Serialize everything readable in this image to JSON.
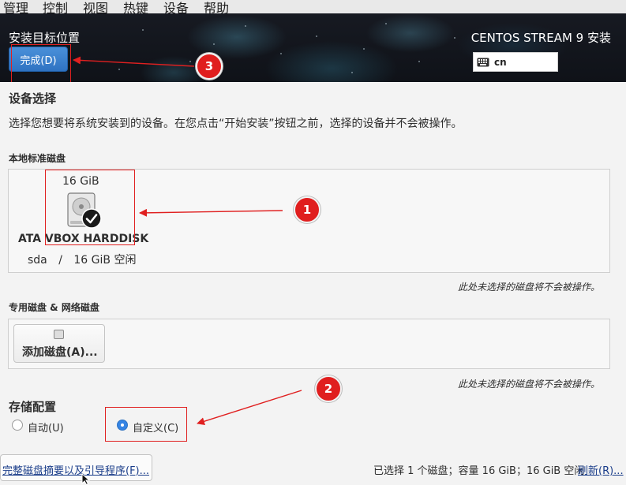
{
  "menubar": {
    "items": [
      "管理",
      "控制",
      "视图",
      "热键",
      "设备",
      "帮助"
    ]
  },
  "header": {
    "title": "安装目标位置",
    "product": "CENTOS STREAM 9 安装",
    "done_label": "完成(D)",
    "keyboard_layout": "cn",
    "keyboard_icon": "keyboard-icon"
  },
  "device_selection": {
    "heading": "设备选择",
    "description": "选择您想要将系统安装到的设备。在您点击“开始安装”按钮之前，选择的设备并不会被操作。"
  },
  "local_disks": {
    "heading": "本地标准磁盘",
    "disk": {
      "size": "16 GiB",
      "name": "ATA VBOX HARDDISK",
      "device": "sda",
      "separator": "/",
      "free": "16 GiB 空闲",
      "icon": "harddisk-icon",
      "selected": true
    },
    "note": "此处未选择的磁盘将不会被操作。"
  },
  "special_disks": {
    "heading": "专用磁盘 & 网络磁盘",
    "add_disk_label": "添加磁盘(A)...",
    "note": "此处未选择的磁盘将不会被操作。"
  },
  "storage_config": {
    "heading": "存储配置",
    "options": [
      {
        "label": "自动(U)",
        "selected": false
      },
      {
        "label": "自定义(C)",
        "selected": true
      }
    ]
  },
  "footer": {
    "summary_link": "完整磁盘摘要以及引导程序(F)...",
    "status": "已选择 1 个磁盘；容量 16 GiB；16 GiB 空闲",
    "refresh_link": "刷新(R)..."
  },
  "annotations": {
    "badges": [
      "1",
      "2",
      "3"
    ],
    "color": "#e01e1e"
  },
  "colors": {
    "accent": "#3584e4",
    "annotation": "#e02020",
    "header_bg": "#12161d"
  }
}
